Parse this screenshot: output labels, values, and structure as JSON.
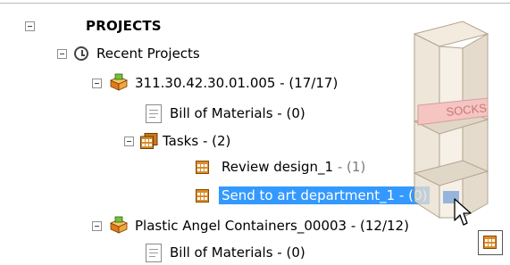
{
  "tree": {
    "root_label": "PROJECTS",
    "recent_label": "Recent Projects",
    "project1": {
      "name": "311.30.42.30.01.005 - (",
      "count": "17/17",
      "bom_label": "Bill of Materials - (0)",
      "tasks_label": "Tasks - (2)",
      "task1_name": "Review design_1",
      "task1_count": " - (1)",
      "task2_name": "Send to art department_1 - (0)"
    },
    "project2": {
      "name": "Plastic Angel Containers_00003 - (",
      "count": "12/12",
      "bom_label": "Bill of Materials - (0)"
    }
  },
  "drag_preview": {
    "box_text": "SOCKS"
  }
}
